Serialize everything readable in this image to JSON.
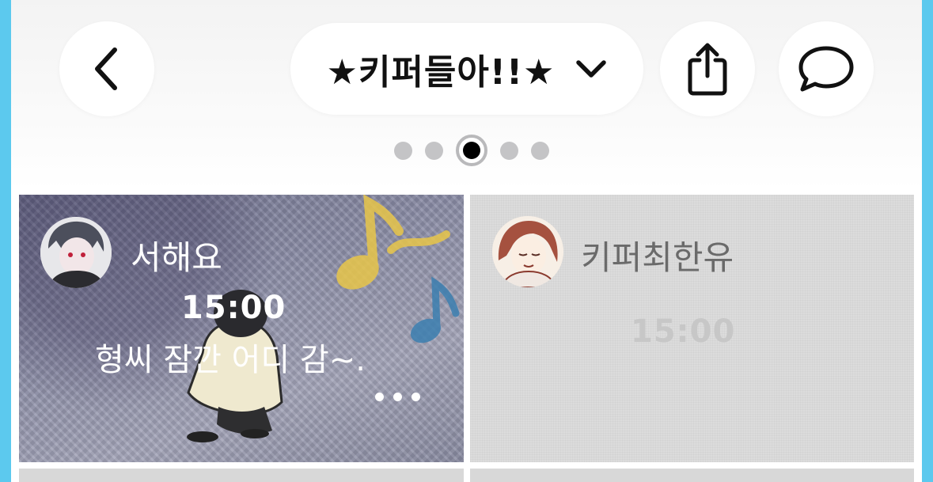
{
  "header": {
    "title": "★키퍼들아!!★",
    "back_icon": "chevron-left-icon",
    "title_dropdown_icon": "chevron-down-icon",
    "share_icon": "share-icon",
    "chat_icon": "speech-bubble-icon"
  },
  "pager": {
    "count": 5,
    "active_index": 2
  },
  "posts": [
    {
      "author": "서해요",
      "time": "15:00",
      "message": "형씨 잠깐 어디 감~.",
      "has_more": true
    },
    {
      "author": "키퍼최한유",
      "time": "15:00",
      "message": ""
    }
  ],
  "colors": {
    "frame": "#5cc9ee",
    "active_dot": "#000000",
    "inactive_dot": "#c4c4c6"
  }
}
